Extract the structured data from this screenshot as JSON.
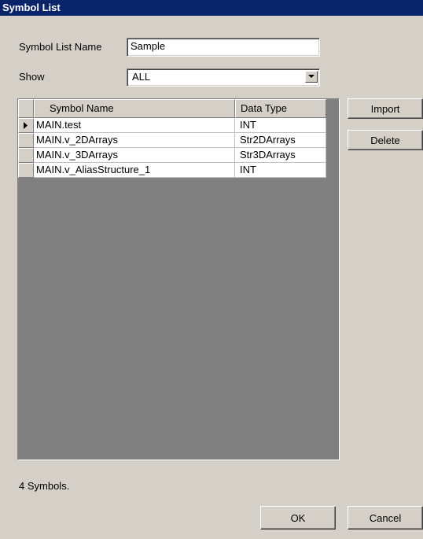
{
  "window": {
    "title": "Symbol List"
  },
  "form": {
    "name_label": "Symbol List Name",
    "name_value": "Sample",
    "show_label": "Show",
    "show_value": "ALL"
  },
  "grid": {
    "columns": [
      "Symbol Name",
      "Data Type"
    ],
    "rows": [
      {
        "name": "MAIN.test",
        "type": "INT",
        "current": true
      },
      {
        "name": "MAIN.v_2DArrays",
        "type": "Str2DArrays",
        "current": false
      },
      {
        "name": "MAIN.v_3DArrays",
        "type": "Str3DArrays",
        "current": false
      },
      {
        "name": "MAIN.v_AliasStructure_1",
        "type": "INT",
        "current": false
      }
    ]
  },
  "buttons": {
    "import": "Import",
    "delete": "Delete",
    "ok": "OK",
    "cancel": "Cancel"
  },
  "status": {
    "count_text": "4 Symbols."
  },
  "icons": {
    "row_indicator": "right-triangle-icon",
    "dropdown": "chevron-down-icon"
  },
  "colors": {
    "title_bar": "#0a246a",
    "face": "#d4d0c8",
    "grid_empty": "#808080"
  }
}
